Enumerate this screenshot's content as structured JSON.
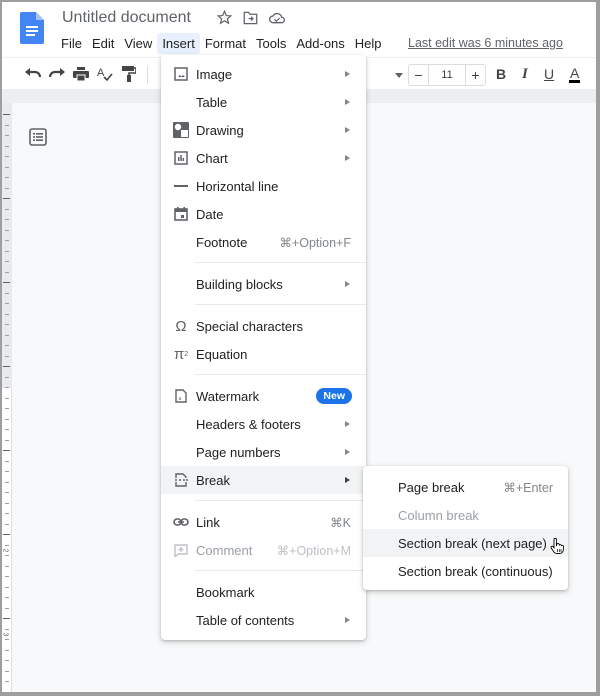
{
  "header": {
    "doc_title": "Untitled document",
    "title_icons": [
      "star-icon",
      "move-to-folder-icon",
      "cloud-status-icon"
    ],
    "menus": [
      "File",
      "Edit",
      "View",
      "Insert",
      "Format",
      "Tools",
      "Add-ons",
      "Help"
    ],
    "active_menu": "Insert",
    "last_edit": "Last edit was 6 minutes ago"
  },
  "toolbar": {
    "icons": [
      "undo-icon",
      "redo-icon",
      "print-icon",
      "spellcheck-icon",
      "paint-format-icon"
    ],
    "font_size": "11",
    "minus": "−",
    "plus": "+",
    "bold": "B",
    "italic": "I",
    "underline": "U",
    "text_color": "A",
    "text_color_value": "#000000"
  },
  "ruler": {
    "labels": [
      "1",
      "2",
      "3"
    ]
  },
  "insert_menu": {
    "items": [
      {
        "label": "Image",
        "icon": "image-icon",
        "submenu": true
      },
      {
        "label": "Table",
        "icon": "",
        "submenu": true
      },
      {
        "label": "Drawing",
        "icon": "drawing-icon",
        "submenu": true
      },
      {
        "label": "Chart",
        "icon": "chart-icon",
        "submenu": true
      },
      {
        "label": "Horizontal line",
        "icon": "horizontal-line-icon"
      },
      {
        "label": "Date",
        "icon": "calendar-icon"
      },
      {
        "label": "Footnote",
        "icon": "",
        "shortcut": "⌘+Option+F"
      },
      {
        "label": "Building blocks",
        "icon": "",
        "submenu": true
      },
      {
        "label": "Special characters",
        "icon": "omega-icon"
      },
      {
        "label": "Equation",
        "icon": "pi-icon"
      },
      {
        "label": "Watermark",
        "icon": "watermark-icon",
        "badge": "New"
      },
      {
        "label": "Headers & footers",
        "icon": "",
        "submenu": true
      },
      {
        "label": "Page numbers",
        "icon": "",
        "submenu": true
      },
      {
        "label": "Break",
        "icon": "break-icon",
        "submenu": true,
        "highlighted": true
      },
      {
        "label": "Link",
        "icon": "link-icon",
        "shortcut": "⌘K"
      },
      {
        "label": "Comment",
        "icon": "comment-icon",
        "shortcut": "⌘+Option+M",
        "disabled": true
      },
      {
        "label": "Bookmark",
        "icon": ""
      },
      {
        "label": "Table of contents",
        "icon": "",
        "submenu": true
      }
    ]
  },
  "break_submenu": {
    "items": [
      {
        "label": "Page break",
        "shortcut": "⌘+Enter"
      },
      {
        "label": "Column break",
        "disabled": true
      },
      {
        "label": "Section break (next page)",
        "hovered": true
      },
      {
        "label": "Section break (continuous)"
      }
    ]
  },
  "colors": {
    "accent": "#1a73e8",
    "docs_blue": "#4285f4",
    "menu_highlight": "#f1f3f4",
    "active_menu_bg": "#e8f0fe"
  }
}
